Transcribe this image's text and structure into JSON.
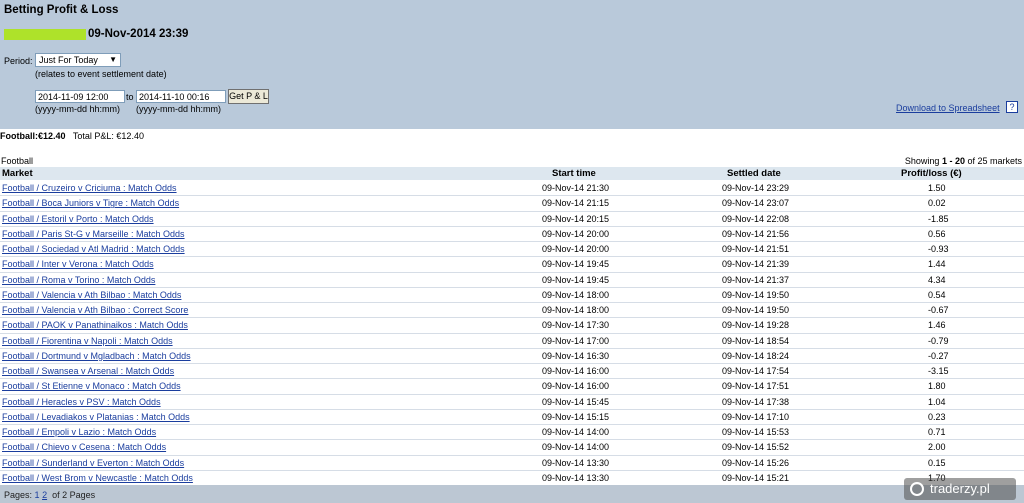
{
  "header": {
    "title": "Betting Profit & Loss",
    "datetime": "09-Nov-2014 23:39"
  },
  "period": {
    "label": "Period:",
    "selected": "Just For Today",
    "note": "(relates to event settlement date)"
  },
  "range": {
    "from": "2014-11-09 12:00",
    "to_label": "to",
    "to": "2014-11-10 00:16",
    "button": "Get P & L",
    "format": "(yyyy-mm-dd hh:mm)"
  },
  "download": {
    "label": "Download to Spreadsheet",
    "help": "?"
  },
  "summary": {
    "football_label": "Football:",
    "football_value": "€12.40",
    "total_label": "Total P&L:",
    "total_value": "€12.40"
  },
  "section": {
    "title": "Football",
    "showing_prefix": "Showing",
    "showing_range": "1 - 20",
    "showing_suffix": "of 25 markets"
  },
  "columns": {
    "market": "Market",
    "start": "Start time",
    "settled": "Settled date",
    "pl": "Profit/loss (€)"
  },
  "rows": [
    {
      "market": "Football / Cruzeiro v Criciuma : Match Odds",
      "start": "09-Nov-14 21:30",
      "settled": "09-Nov-14 23:29",
      "pl": "1.50"
    },
    {
      "market": "Football / Boca Juniors v Tigre : Match Odds",
      "start": "09-Nov-14 21:15",
      "settled": "09-Nov-14 23:07",
      "pl": "0.02"
    },
    {
      "market": "Football / Estoril v Porto : Match Odds",
      "start": "09-Nov-14 20:15",
      "settled": "09-Nov-14 22:08",
      "pl": "-1.85"
    },
    {
      "market": "Football / Paris St-G v Marseille : Match Odds",
      "start": "09-Nov-14 20:00",
      "settled": "09-Nov-14 21:56",
      "pl": "0.56"
    },
    {
      "market": "Football / Sociedad v Atl Madrid : Match Odds",
      "start": "09-Nov-14 20:00",
      "settled": "09-Nov-14 21:51",
      "pl": "-0.93"
    },
    {
      "market": "Football / Inter v Verona : Match Odds",
      "start": "09-Nov-14 19:45",
      "settled": "09-Nov-14 21:39",
      "pl": "1.44"
    },
    {
      "market": "Football / Roma v Torino : Match Odds",
      "start": "09-Nov-14 19:45",
      "settled": "09-Nov-14 21:37",
      "pl": "4.34"
    },
    {
      "market": "Football / Valencia v Ath Bilbao : Match Odds",
      "start": "09-Nov-14 18:00",
      "settled": "09-Nov-14 19:50",
      "pl": "0.54"
    },
    {
      "market": "Football / Valencia v Ath Bilbao : Correct Score",
      "start": "09-Nov-14 18:00",
      "settled": "09-Nov-14 19:50",
      "pl": "-0.67"
    },
    {
      "market": "Football / PAOK v Panathinaikos : Match Odds",
      "start": "09-Nov-14 17:30",
      "settled": "09-Nov-14 19:28",
      "pl": "1.46"
    },
    {
      "market": "Football / Fiorentina v Napoli : Match Odds",
      "start": "09-Nov-14 17:00",
      "settled": "09-Nov-14 18:54",
      "pl": "-0.79"
    },
    {
      "market": "Football / Dortmund v Mgladbach : Match Odds",
      "start": "09-Nov-14 16:30",
      "settled": "09-Nov-14 18:24",
      "pl": "-0.27"
    },
    {
      "market": "Football / Swansea v Arsenal : Match Odds",
      "start": "09-Nov-14 16:00",
      "settled": "09-Nov-14 17:54",
      "pl": "-3.15"
    },
    {
      "market": "Football / St Etienne v Monaco : Match Odds",
      "start": "09-Nov-14 16:00",
      "settled": "09-Nov-14 17:51",
      "pl": "1.80"
    },
    {
      "market": "Football / Heracles v PSV : Match Odds",
      "start": "09-Nov-14 15:45",
      "settled": "09-Nov-14 17:38",
      "pl": "1.04"
    },
    {
      "market": "Football / Levadiakos v Platanias : Match Odds",
      "start": "09-Nov-14 15:15",
      "settled": "09-Nov-14 17:10",
      "pl": "0.23"
    },
    {
      "market": "Football / Empoli v Lazio : Match Odds",
      "start": "09-Nov-14 14:00",
      "settled": "09-Nov-14 15:53",
      "pl": "0.71"
    },
    {
      "market": "Football / Chievo v Cesena : Match Odds",
      "start": "09-Nov-14 14:00",
      "settled": "09-Nov-14 15:52",
      "pl": "2.00"
    },
    {
      "market": "Football / Sunderland v Everton : Match Odds",
      "start": "09-Nov-14 13:30",
      "settled": "09-Nov-14 15:26",
      "pl": "0.15"
    },
    {
      "market": "Football / West Brom v Newcastle : Match Odds",
      "start": "09-Nov-14 13:30",
      "settled": "09-Nov-14 15:21",
      "pl": "1.70"
    }
  ],
  "pagination": {
    "label": "Pages:",
    "page1": "1",
    "page2": "2",
    "summary": "of 2 Pages"
  },
  "watermark": {
    "text": "traderzy.pl"
  }
}
